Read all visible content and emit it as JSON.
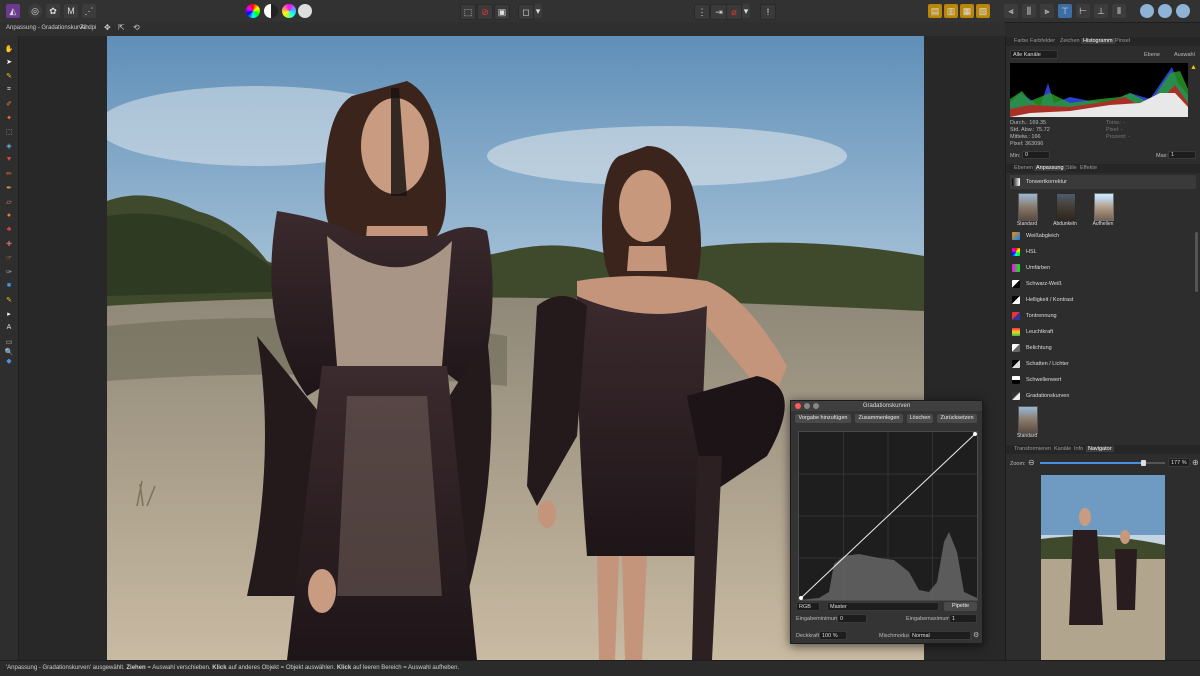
{
  "toolbar": {
    "persona_icons": [
      "photo-persona-icon",
      "liquify-persona-icon",
      "develop-persona-icon",
      "tone-mapping-persona-icon",
      "export-persona-icon"
    ]
  },
  "context_bar": {
    "layer_label": "Anpassung - Gradationskurven",
    "dpi": "72 dpi"
  },
  "panels": {
    "top_tabs": [
      "Farbe",
      "Farbfelder",
      "Zeichen",
      "Histogramm",
      "Pinsel"
    ],
    "top_active": "Histogramm",
    "histogram": {
      "channel": "Alle Kanäle",
      "layer_label": "Ebene",
      "warn_label": "Auswahl",
      "stats_left": [
        "Durch.: 169.35",
        "Std. Abw.: 75.72",
        "Mittelw.: 166",
        "Pixel: 363096"
      ],
      "stats_right": [
        "Tonw.: -",
        "Pixel: -",
        "Prozent: -"
      ],
      "min_label": "Min:",
      "min_value": "0",
      "max_label": "Max:",
      "max_value": "1"
    },
    "mid_tabs": [
      "Ebenen",
      "Anpassung",
      "Stile",
      "Effekte"
    ],
    "mid_active": "Anpassung",
    "adjustments": {
      "header": "Tonwertkorrektur",
      "presets": [
        "Standard",
        "Abdunkeln",
        "Aufhellen"
      ],
      "items": [
        "Weißabgleich",
        "HSL",
        "Umfärben",
        "Schwarz-Weiß",
        "Helligkeit / Kontrast",
        "Tontrennung",
        "Leuchtkraft",
        "Belichtung",
        "Schatten / Lichter",
        "Schwellenwert",
        "Gradationskurven"
      ],
      "bottom_preset": "Standard"
    },
    "bottom_tabs": [
      "Transformieren",
      "Kanäle",
      "Info",
      "Navigator"
    ],
    "bottom_active": "Navigator",
    "navigator": {
      "zoom_label": "Zoom:",
      "zoom_value": "177 %",
      "zoom_fraction": 0.82
    }
  },
  "curves_dialog": {
    "title": "Gradationskurven",
    "buttons": [
      "Vorgabe hinzufügen",
      "Zusammenlegen",
      "Löschen",
      "Zurücksetzen"
    ],
    "color_model": "RGB",
    "channel": "Master",
    "picker_label": "Pipette",
    "input_min_label": "Eingabeminimum:",
    "input_min_value": "0",
    "input_max_label": "Eingabemaximum:",
    "input_max_value": "1",
    "opacity_label": "Deckkraft:",
    "opacity_value": "100 %",
    "blend_label": "Mischmodus:",
    "blend_value": "Normal"
  },
  "status": {
    "q1": "'Anpassung - Gradationskurven' ausgewählt. ",
    "k1": "Ziehen",
    "t1": " = Auswahl verschieben. ",
    "k2": "Klick",
    "t2": " auf anderes Objekt = Objekt auswählen. ",
    "k3": "Klick",
    "t3": " auf leeren Bereich = Auswahl aufheben."
  },
  "colors": {
    "accent": "#f5c400",
    "active_tab": "#3c3c3c",
    "app_bg": "#2b2b2b"
  }
}
